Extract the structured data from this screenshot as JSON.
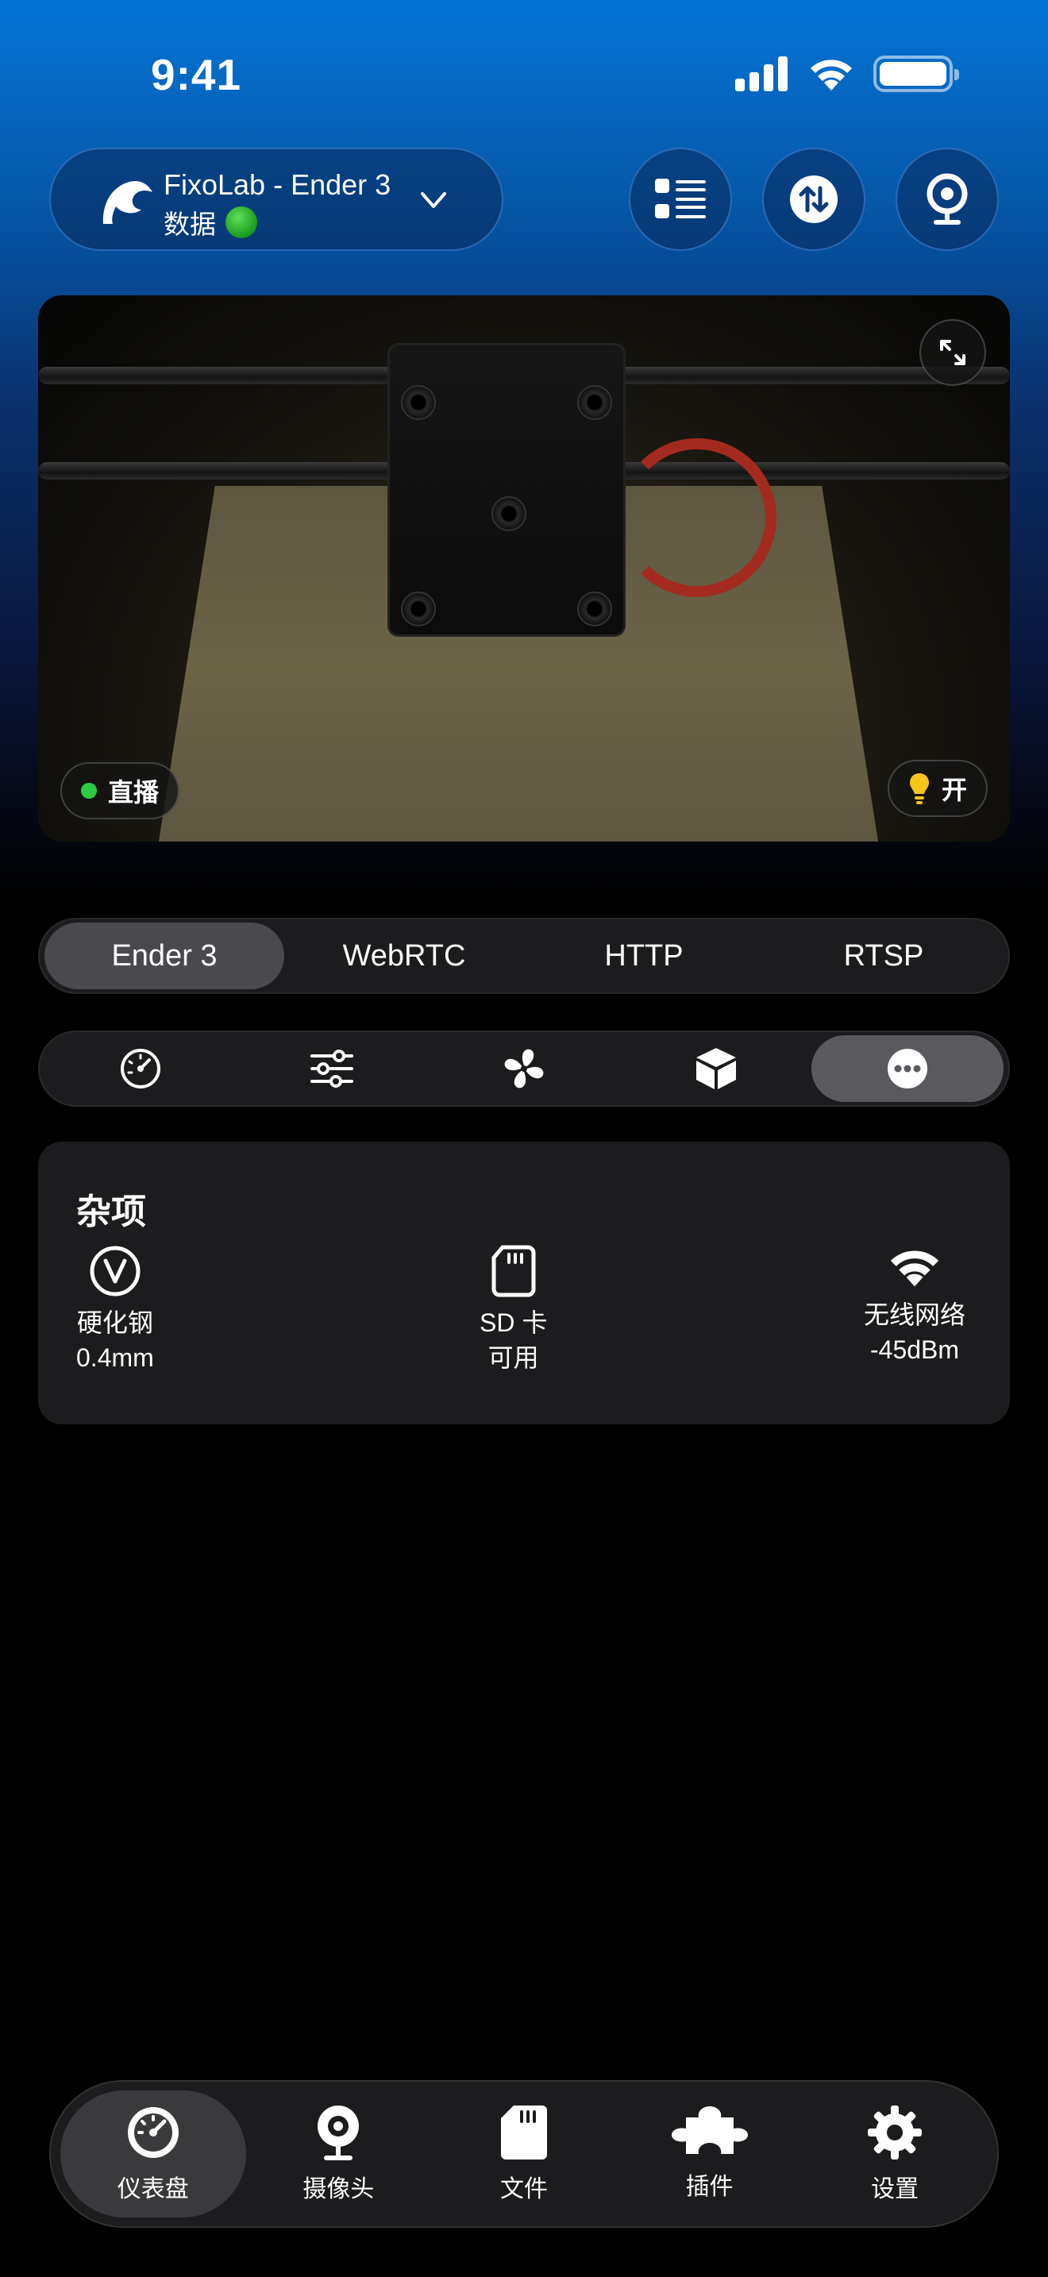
{
  "status_bar": {
    "time": "9:41"
  },
  "header": {
    "printer_name": "FixoLab - Ender 3",
    "printer_subtitle": "数据",
    "status_color": "#22b022"
  },
  "camera": {
    "live_label": "直播",
    "light_label": "开",
    "live_color": "#2ecc40"
  },
  "segmented": {
    "tabs": [
      {
        "label": "Ender 3",
        "active": true
      },
      {
        "label": "WebRTC",
        "active": false
      },
      {
        "label": "HTTP",
        "active": false
      },
      {
        "label": "RTSP",
        "active": false
      }
    ]
  },
  "icon_tabs": [
    {
      "icon": "gauge-icon",
      "active": false
    },
    {
      "icon": "sliders-icon",
      "active": false
    },
    {
      "icon": "fan-icon",
      "active": false
    },
    {
      "icon": "box-icon",
      "active": false
    },
    {
      "icon": "more-icon",
      "active": true
    }
  ],
  "misc": {
    "title": "杂项",
    "nozzle": {
      "label": "硬化钢",
      "value": "0.4mm",
      "icon": "v-circle-icon"
    },
    "sd": {
      "label": "SD 卡",
      "value": "可用",
      "icon": "sd-card-icon"
    },
    "wifi": {
      "label": "无线网络",
      "value": "-45dBm",
      "icon": "wifi-icon"
    }
  },
  "tabbar": {
    "items": [
      {
        "label": "仪表盘",
        "icon": "dashboard-icon",
        "active": true
      },
      {
        "label": "摄像头",
        "icon": "webcam-icon",
        "active": false
      },
      {
        "label": "文件",
        "icon": "file-card-icon",
        "active": false
      },
      {
        "label": "插件",
        "icon": "puzzle-icon",
        "active": false
      },
      {
        "label": "设置",
        "icon": "gear-icon",
        "active": false
      }
    ]
  },
  "colors": {
    "accent_bg": "#0474d6",
    "card_bg": "#1c1c1e",
    "light_bulb": "#f5c518"
  }
}
